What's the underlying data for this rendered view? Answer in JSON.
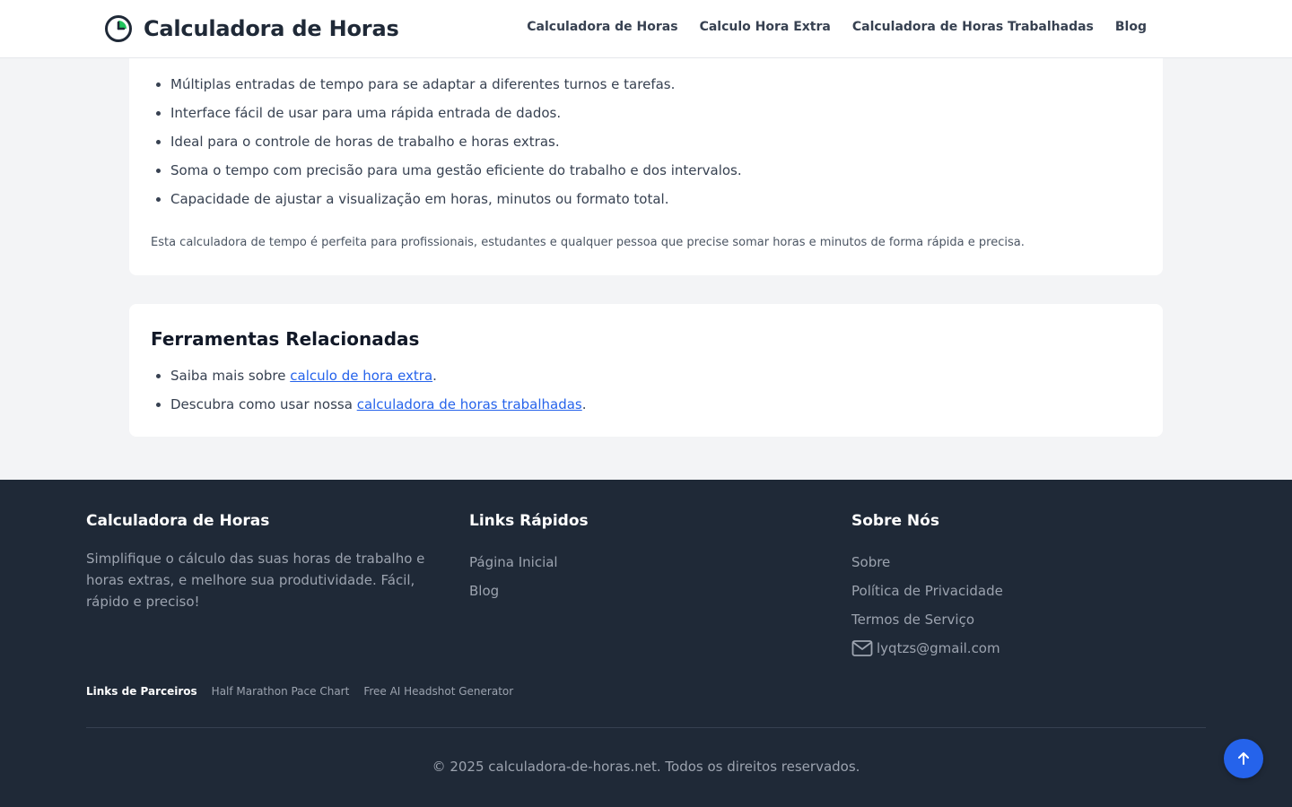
{
  "header": {
    "brand_title": "Calculadora de Horas",
    "nav": [
      "Calculadora de Horas",
      "Calculo Hora Extra",
      "Calculadora de Horas Trabalhadas",
      "Blog"
    ]
  },
  "features": {
    "items": [
      "Múltiplas entradas de tempo para se adaptar a diferentes turnos e tarefas.",
      "Interface fácil de usar para uma rápida entrada de dados.",
      "Ideal para o controle de horas de trabalho e horas extras.",
      "Soma o tempo com precisão para uma gestão eficiente do trabalho e dos intervalos.",
      "Capacidade de ajustar a visualização em horas, minutos ou formato total."
    ],
    "note": "Esta calculadora de tempo é perfeita para profissionais, estudantes e qualquer pessoa que precise somar horas e minutos de forma rápida e precisa."
  },
  "related": {
    "title": "Ferramentas Relacionadas",
    "item1_prefix": "Saiba mais sobre ",
    "item1_link": "calculo de hora extra",
    "item1_suffix": ".",
    "item2_prefix": "Descubra como usar nossa ",
    "item2_link": "calculadora de horas trabalhadas",
    "item2_suffix": "."
  },
  "footer": {
    "col1_title": "Calculadora de Horas",
    "col1_text": "Simplifique o cálculo das suas horas de trabalho e horas extras, e melhore sua produtividade. Fácil, rápido e preciso!",
    "col2_title": "Links Rápidos",
    "col2_links": [
      "Página Inicial",
      "Blog"
    ],
    "col3_title": "Sobre Nós",
    "col3_links": [
      "Sobre",
      "Política de Privacidade",
      "Termos de Serviço"
    ],
    "email": "lyqtzs@gmail.com",
    "partners_label": "Links de Parceiros",
    "partners": [
      "Half Marathon Pace Chart",
      "Free AI Headshot Generator"
    ],
    "copyright": "© 2025 calculadora-de-horas.net. Todos os direitos reservados."
  },
  "colors": {
    "accent": "#2563eb",
    "footer_bg": "#1f2937",
    "page_bg": "#f3f4f6",
    "logo_green": "#22c55e"
  },
  "icons": {
    "logo": "clock-logo-icon",
    "email": "envelope-icon",
    "back_to_top": "arrow-up-icon"
  }
}
